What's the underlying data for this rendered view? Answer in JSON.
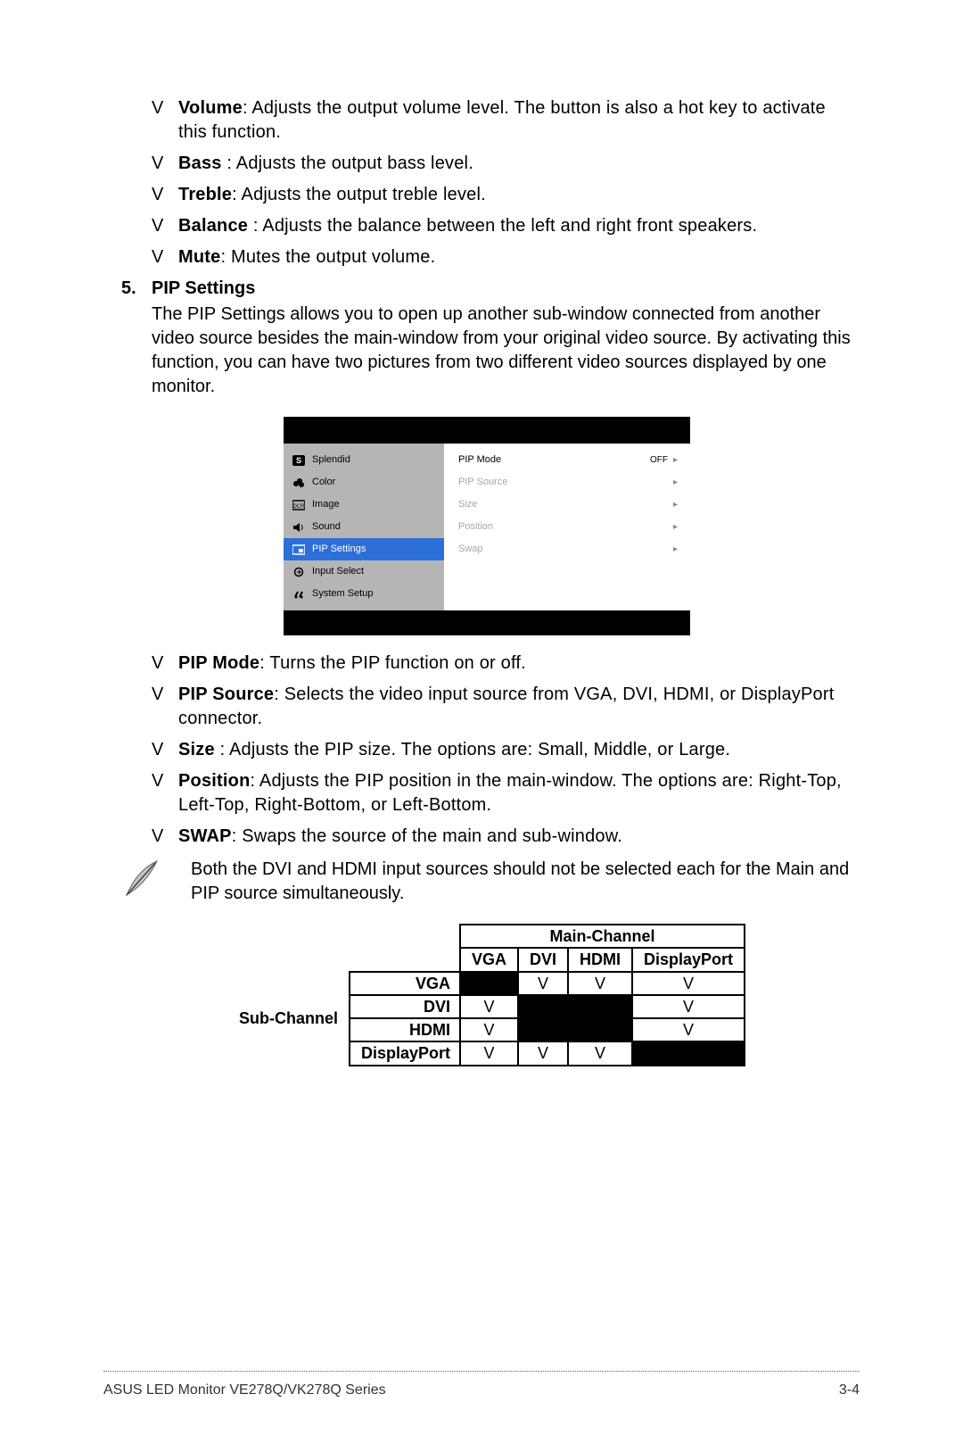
{
  "sound_bullets": [
    {
      "label": "Volume",
      "text": ": Adjusts the output volume level. The          button is also a hot key to activate this function."
    },
    {
      "label": "Bass",
      "text": " : Adjusts the output bass level."
    },
    {
      "label": "Treble",
      "text": ": Adjusts the output treble level."
    },
    {
      "label": "Balance",
      "text": " : Adjusts the balance between the left and right front speakers."
    },
    {
      "label": "Mute",
      "text": ": Mutes the output volume."
    }
  ],
  "section": {
    "num": "5.",
    "title": "PIP Settings",
    "body": "The PIP Settings allows you to open up another sub-window connected from another video source besides the main-window from your original video source. By activating this function, you can have two pictures from two different video sources displayed by one monitor."
  },
  "osd": {
    "left": [
      {
        "icon": "s",
        "label": "Splendid"
      },
      {
        "icon": "col",
        "label": "Color"
      },
      {
        "icon": "img",
        "label": "Image"
      },
      {
        "icon": "snd",
        "label": "Sound"
      },
      {
        "icon": "pip",
        "label": "PIP Settings",
        "selected": true
      },
      {
        "icon": "inp",
        "label": "Input Select"
      },
      {
        "icon": "sys",
        "label": "System Setup"
      }
    ],
    "right": [
      {
        "label": "PIP Mode",
        "value": "OFF",
        "arrow": "▸",
        "active": true
      },
      {
        "label": "PIP Source",
        "arrow": "▸"
      },
      {
        "label": "Size",
        "arrow": "▸"
      },
      {
        "label": "Position",
        "arrow": "▸"
      },
      {
        "label": "Swap",
        "arrow": "▸"
      }
    ]
  },
  "pip_bullets": [
    {
      "label": "PIP Mode",
      "text": ": Turns the PIP function on or off."
    },
    {
      "label": "PIP Source",
      "text": ": Selects the video input source from VGA, DVI, HDMI, or DisplayPort connector."
    },
    {
      "label": "Size",
      "text": " : Adjusts the PIP size. The options are: Small, Middle, or Large."
    },
    {
      "label": "Position",
      "text": ": Adjusts the PIP position in the main-window. The options are: Right-Top, Left-Top, Right-Bottom, or Left-Bottom."
    },
    {
      "label": "SWAP",
      "text": ": Swaps the source of the main and sub-window."
    }
  ],
  "note": "Both the DVI and HDMI input sources should not be selected each for the Main and PIP source simultaneously.",
  "table": {
    "main_header": "Main-Channel",
    "sub_header": "Sub-Channel",
    "cols": [
      "VGA",
      "DVI",
      "HDMI",
      "DisplayPort"
    ],
    "rows": [
      {
        "label": "VGA",
        "cells": [
          "blk",
          "V",
          "V",
          "V"
        ]
      },
      {
        "label": "DVI",
        "cells": [
          "V",
          "blk",
          "blk",
          "V"
        ]
      },
      {
        "label": "HDMI",
        "cells": [
          "V",
          "blk",
          "blk",
          "V"
        ]
      },
      {
        "label": "DisplayPort",
        "cells": [
          "V",
          "V",
          "V",
          "blk"
        ]
      }
    ]
  },
  "footer": {
    "left": "ASUS LED Monitor VE278Q/VK278Q Series",
    "right": "3-4"
  }
}
